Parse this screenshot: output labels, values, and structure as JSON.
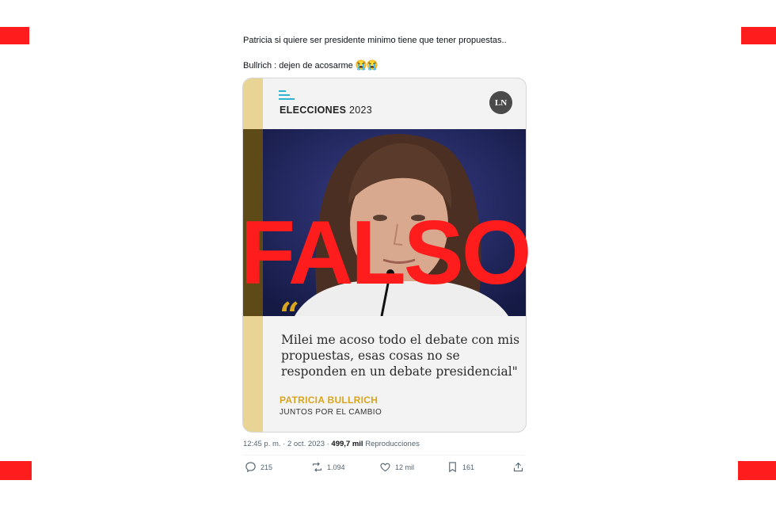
{
  "tweet": {
    "line1": "Patricia si quiere ser presidente minimo tiene que tener propuestas..",
    "line2_text": "Bullrich : dejen de acosarme ",
    "line2_emoji": "😭😭"
  },
  "media": {
    "header_label_bold": "ELECCIONES",
    "header_label_year": " 2023",
    "outlet_badge": "LN",
    "quote_mark": "“",
    "quote": "Milei me acoso todo el debate con mis propuestas, esas cosas no se responden en un debate presidencial\"",
    "author": "PATRICIA BULLRICH",
    "party": "JUNTOS POR EL CAMBIO"
  },
  "overlay": {
    "stamp": "FALSO"
  },
  "meta": {
    "time": "12:45 p. m. · 2 oct. 2023 · ",
    "views_count": "499,7 mil",
    "views_label": " Reproducciones"
  },
  "actions": {
    "reply_count": "215",
    "retweet_count": "1.094",
    "like_count": "12 mil",
    "bookmark_count": "161"
  },
  "colors": {
    "stamp": "#ff1c1c",
    "accent_gold": "#d9a51d",
    "side_bar": "#e8d596",
    "logo_blue": "#2fb3d3"
  }
}
